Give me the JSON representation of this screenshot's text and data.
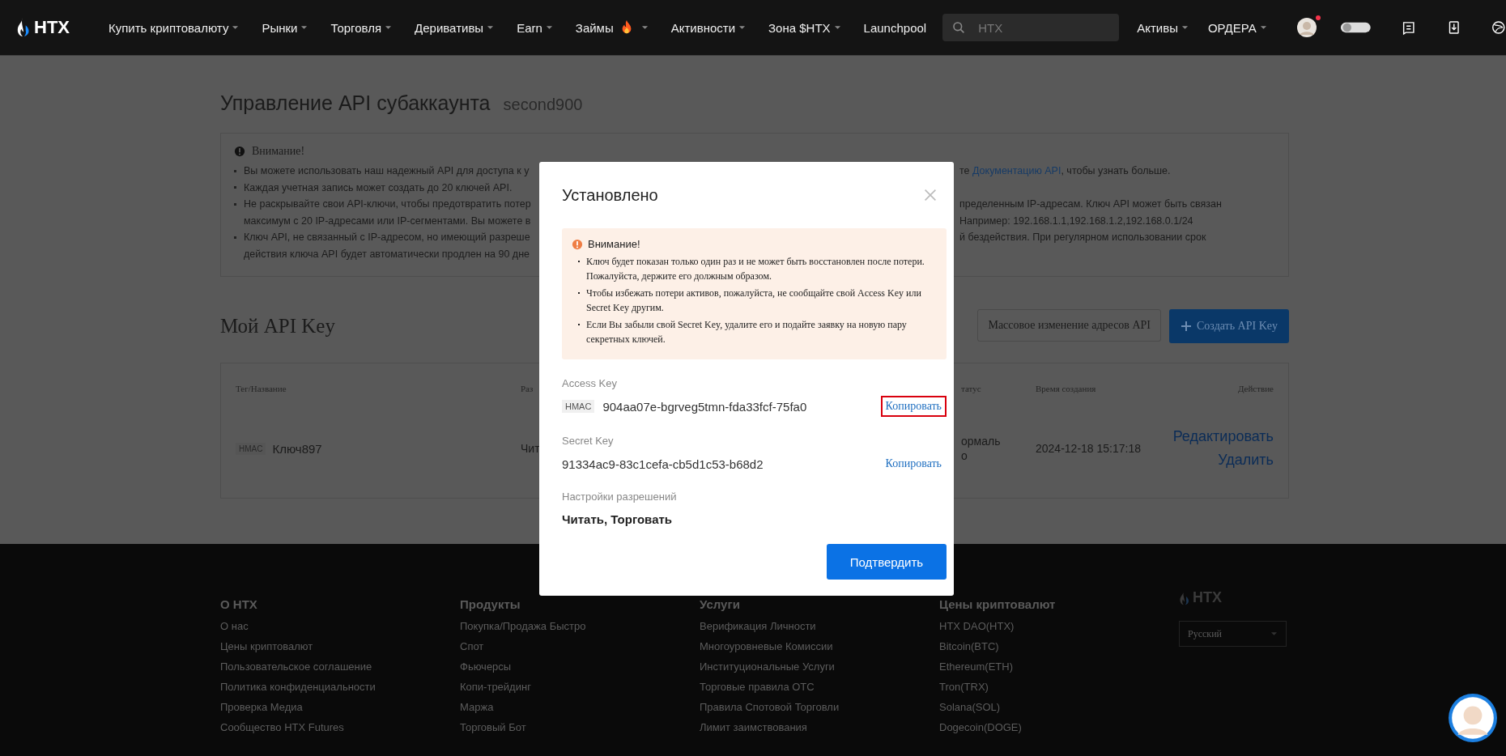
{
  "header": {
    "logo": "HTX",
    "nav": [
      {
        "label": "Купить криптовалюту",
        "dropdown": true,
        "hot": false
      },
      {
        "label": "Рынки",
        "dropdown": true,
        "hot": false
      },
      {
        "label": "Торговля",
        "dropdown": true,
        "hot": false
      },
      {
        "label": "Деривативы",
        "dropdown": true,
        "hot": false
      },
      {
        "label": "Earn",
        "dropdown": true,
        "hot": false
      },
      {
        "label": "Займы",
        "dropdown": true,
        "hot": true
      },
      {
        "label": "Активности",
        "dropdown": true,
        "hot": false
      },
      {
        "label": "Зона $HTX",
        "dropdown": true,
        "hot": false
      },
      {
        "label": "Launchpool",
        "dropdown": false,
        "hot": false
      }
    ],
    "search": {
      "placeholder": "HTX"
    },
    "menus": [
      {
        "label": "Активы"
      },
      {
        "label": "ОРДЕРА"
      }
    ],
    "notification_dot": true
  },
  "page": {
    "title": "Управление API субаккаунта",
    "subaccount": "second900",
    "notice": {
      "title": "Внимание!",
      "bullets": [
        {
          "rows": [
            {
              "left": "Вы можете использовать наш надежный API для доступа к у",
              "right": [
                {
                  "kind": "text",
                  "text": "те "
                },
                {
                  "kind": "link",
                  "text": "Документацию API"
                },
                {
                  "kind": "text",
                  "text": ", чтобы узнать больше."
                }
              ]
            }
          ]
        },
        {
          "rows": [
            {
              "left": "Каждая учетная запись может создать до 20 ключей API."
            }
          ]
        },
        {
          "rows": [
            {
              "left": "Не раскрывайте свои API-ключи, чтобы предотвратить потер",
              "right": [
                {
                  "kind": "text",
                  "text": "пределенным IP-адресам. Ключ API может быть связан"
                }
              ]
            },
            {
              "left": "максимум с 20 IP-адресами или IP-сегментами. Вы можете в",
              "right": [
                {
                  "kind": "text",
                  "text": "Например: 192.168.1.1,192.168.1.2,192.168.0.1/24"
                }
              ]
            }
          ]
        },
        {
          "rows": [
            {
              "left": "Ключ API, не связанный с IP-адресом, но имеющий разреше",
              "right": [
                {
                  "kind": "text",
                  "text": "й бездействия. При регулярном использовании срок"
                }
              ]
            },
            {
              "left": "действия ключа API будет автоматически продлен на 90 дне"
            }
          ]
        }
      ]
    },
    "keys_title": "Мой API Key",
    "buttons": [
      {
        "label": "Массовое изменение адресов API",
        "kind": "secondary"
      },
      {
        "label": "Создать API Key",
        "kind": "primary"
      }
    ],
    "table": {
      "columns": [
        "Тег/Название",
        "Раз",
        "татус",
        "Время создания",
        "Действие"
      ],
      "rows": [
        {
          "tag": "HMAC",
          "name": "Ключ897",
          "column_2": "Чит",
          "status": [
            "ормаль",
            "о"
          ],
          "created": "2024-12-18 15:17:18",
          "actions": [
            "Редактировать",
            "Удалить"
          ]
        }
      ]
    }
  },
  "modal": {
    "title": "Установлено",
    "warning": {
      "title": "Внимание!",
      "items": [
        "Ключ будет показан только один раз и не может быть восстановлен после потери. Пожалуйста, держите его должным образом.",
        "Чтобы избежать потери активов, пожалуйста, не сообщайте свой Access Key или Secret Key другим.",
        "Если Вы забыли свой Secret Key, удалите его и подайте заявку на новую пару секретных ключей."
      ]
    },
    "keys": [
      {
        "label": "Access Key",
        "tag": "HMAC",
        "value": "904aa07e-bgrveg5tmn-fda33fcf-75fa0",
        "copy": "Копировать",
        "highlighted": true
      },
      {
        "label": "Secret Key",
        "value": "91334ac9-83c1cefa-cb5d1c53-b68d2",
        "copy": "Копировать",
        "highlighted": false
      }
    ],
    "permissions_label": "Настройки разрешений",
    "permissions": "Читать, Торговать",
    "confirm": "Подтвердить"
  },
  "footer": {
    "columns": [
      {
        "title": "О HTX",
        "links": [
          "О нас",
          "Цены криптовалют",
          "Пользовательское соглашение",
          "Политика конфиденциальности",
          "Проверка Медиа",
          "Сообщество HTX Futures"
        ]
      },
      {
        "title": "Продукты",
        "links": [
          "Покупка/Продажа Быстро",
          "Спот",
          "Фьючерсы",
          "Копи-трейдинг",
          "Маржа",
          "Торговый Бот"
        ]
      },
      {
        "title": "Услуги",
        "links": [
          "Верификация Личности",
          "Многоуровневые Комиссии",
          "Институциональные Услуги",
          "Торговые правила OTC",
          "Правила Спотовой Торговли",
          "Лимит заимствования"
        ]
      },
      {
        "title": "Цены криптовалют",
        "links": [
          "HTX DAO(HTX)",
          "Bitcoin(BTC)",
          "Ethereum(ETH)",
          "Tron(TRX)",
          "Solana(SOL)",
          "Dogecoin(DOGE)"
        ]
      }
    ],
    "logo": "HTX",
    "language": "Русский"
  }
}
